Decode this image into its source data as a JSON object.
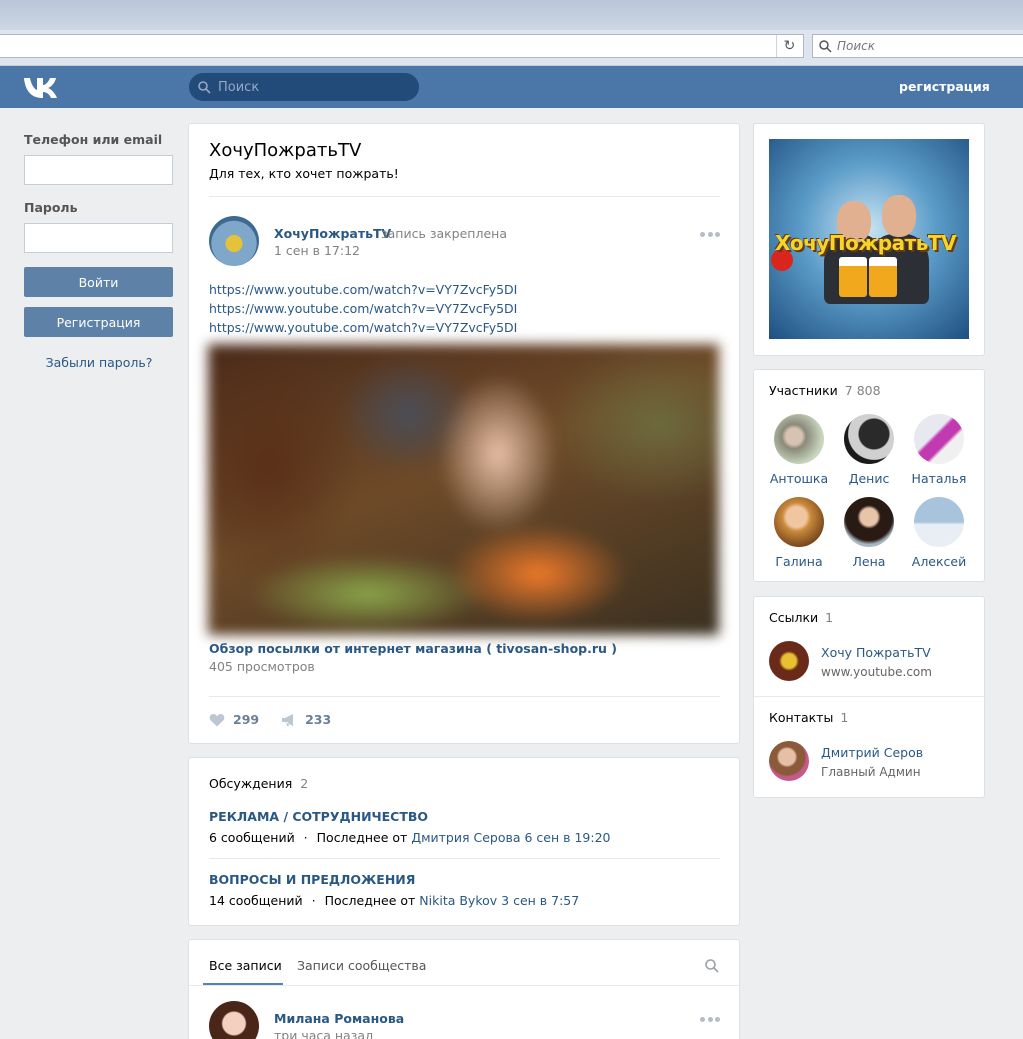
{
  "browser": {
    "search_placeholder": "Поиск"
  },
  "header": {
    "search_placeholder": "Поиск",
    "register_link": "регистрация"
  },
  "login": {
    "phone_label": "Телефон или email",
    "password_label": "Пароль",
    "login_button": "Войти",
    "register_button": "Регистрация",
    "forgot_link": "Забыли пароль?"
  },
  "group": {
    "title": "ХочуПожратьTV",
    "description": "Для тех, кто хочет пожрать!"
  },
  "pinned_post": {
    "author": "ХочуПожратьTV",
    "pinned_label": "запись закреплена",
    "date": "1 сен в 17:12",
    "links": [
      "https://www.youtube.com/watch?v=VY7ZvcFy5DI",
      "https://www.youtube.com/watch?v=VY7ZvcFy5DI",
      "https://www.youtube.com/watch?v=VY7ZvcFy5DI"
    ],
    "video_title": "Обзор посылки от интернет магазина ( tivosan-shop.ru )",
    "video_views": "405 просмотров",
    "likes": "299",
    "shares": "233"
  },
  "discussions": {
    "title": "Обсуждения",
    "count": "2",
    "topics": [
      {
        "title": "РЕКЛАМА / СОТРУДНИЧЕСТВО",
        "messages": "6 сообщений",
        "sep": "·",
        "last_prefix": "Последнее от",
        "last_author": "Дмитрия Серова",
        "last_date": "6 сен в 19:20"
      },
      {
        "title": "ВОПРОСЫ И ПРЕДЛОЖЕНИЯ",
        "messages": "14 сообщений",
        "sep": "·",
        "last_prefix": "Последнее от",
        "last_author": "Nikita Bykov",
        "last_date": "3 сен в 7:57"
      }
    ]
  },
  "wall": {
    "tabs": [
      "Все записи",
      "Записи сообщества"
    ],
    "post_author": "Милана Романова",
    "post_date": "три часа назад"
  },
  "cover": {
    "text": "ХочуПожратьTV"
  },
  "members": {
    "title": "Участники",
    "count": "7 808",
    "people": [
      "Антошка",
      "Денис",
      "Наталья",
      "Галина",
      "Лена",
      "Алексей"
    ]
  },
  "links": {
    "title": "Ссылки",
    "count": "1",
    "item_title": "Хочу ПожратьTV",
    "item_url": "www.youtube.com"
  },
  "contacts": {
    "title": "Контакты",
    "count": "1",
    "name": "Дмитрий Серов",
    "role": "Главный Админ"
  }
}
